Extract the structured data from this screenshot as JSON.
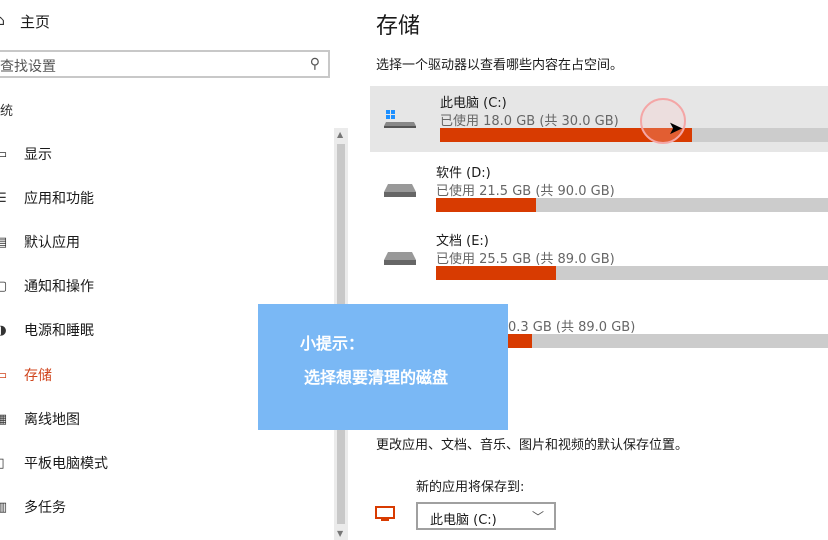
{
  "sidebar": {
    "home_label": "主页",
    "search_placeholder": "查找设置",
    "section_label": "统",
    "items": [
      {
        "label": "显示",
        "icon": "display-icon"
      },
      {
        "label": "应用和功能",
        "icon": "apps-icon"
      },
      {
        "label": "默认应用",
        "icon": "default-apps-icon"
      },
      {
        "label": "通知和操作",
        "icon": "notification-icon"
      },
      {
        "label": "电源和睡眠",
        "icon": "power-icon"
      },
      {
        "label": "存储",
        "icon": "storage-icon",
        "active": true
      },
      {
        "label": "离线地图",
        "icon": "map-icon"
      },
      {
        "label": "平板电脑模式",
        "icon": "tablet-icon"
      },
      {
        "label": "多任务",
        "icon": "multitask-icon"
      }
    ]
  },
  "main": {
    "title": "存储",
    "description": "选择一个驱动器以查看哪些内容在占空间。",
    "drives": [
      {
        "name": "此电脑 (C:)",
        "usage": "已使用 18.0 GB (共 30.0 GB)",
        "used_gb": 18.0,
        "total_gb": 30.0,
        "selected": true
      },
      {
        "name": "软件 (D:)",
        "usage": "已使用 21.5 GB (共 90.0 GB)",
        "used_gb": 21.5,
        "total_gb": 90.0
      },
      {
        "name": "文档 (E:)",
        "usage": "已使用 25.5 GB (共 89.0 GB)",
        "used_gb": 25.5,
        "total_gb": 89.0
      },
      {
        "name": "",
        "usage": "0.3 GB (共 89.0 GB)",
        "used_gb": 20.3,
        "total_gb": 89.0
      }
    ],
    "more_text": "更改应用、文档、音乐、图片和视频的默认保存位置。",
    "new_apps_label": "新的应用将保存到:",
    "new_apps_value": "此电脑 (C:)"
  },
  "tip": {
    "line1": "小提示：",
    "line2": "选择想要清理的磁盘"
  },
  "colors": {
    "accent": "#d83b01",
    "tip_bg": "#7ab8f5",
    "bar_bg": "#cccccc"
  }
}
